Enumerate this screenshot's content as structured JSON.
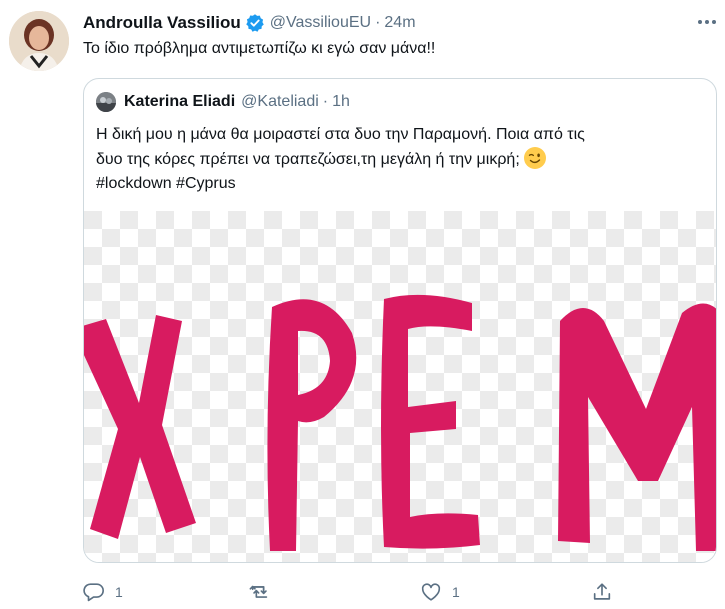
{
  "tweet": {
    "author": {
      "name": "Androulla Vassiliou",
      "handle": "@VassiliouEU",
      "time": "24m",
      "separator": "·"
    },
    "text": "Το ίδιο πρόβλημα αντιμετωπίζω κι εγώ σαν μάνα!!"
  },
  "quoted": {
    "author": {
      "name": "Katerina Eliadi",
      "handle": "@Kateliadi",
      "time": "1h",
      "separator": "·"
    },
    "text_lines": [
      "Η δική μου η μάνα θα μοιραστεί στα δυο την Παραμονή. Ποια από τις",
      "δυο της κόρες πρέπει να τραπεζώσει,τη μεγάλη ή την μικρή;",
      "#lockdown #Cyprus"
    ],
    "emoji": "winking-face",
    "media_letters": [
      "Χ",
      "Ρ",
      "Ε",
      "Μ"
    ]
  },
  "actions": {
    "reply_count": "1",
    "retweet_count": "",
    "like_count": "1"
  },
  "colors": {
    "text": "#0f1419",
    "secondary": "#5b7083",
    "verified": "#1d9bf0",
    "border": "#cfd9de",
    "media_letters": "#d81b60"
  }
}
